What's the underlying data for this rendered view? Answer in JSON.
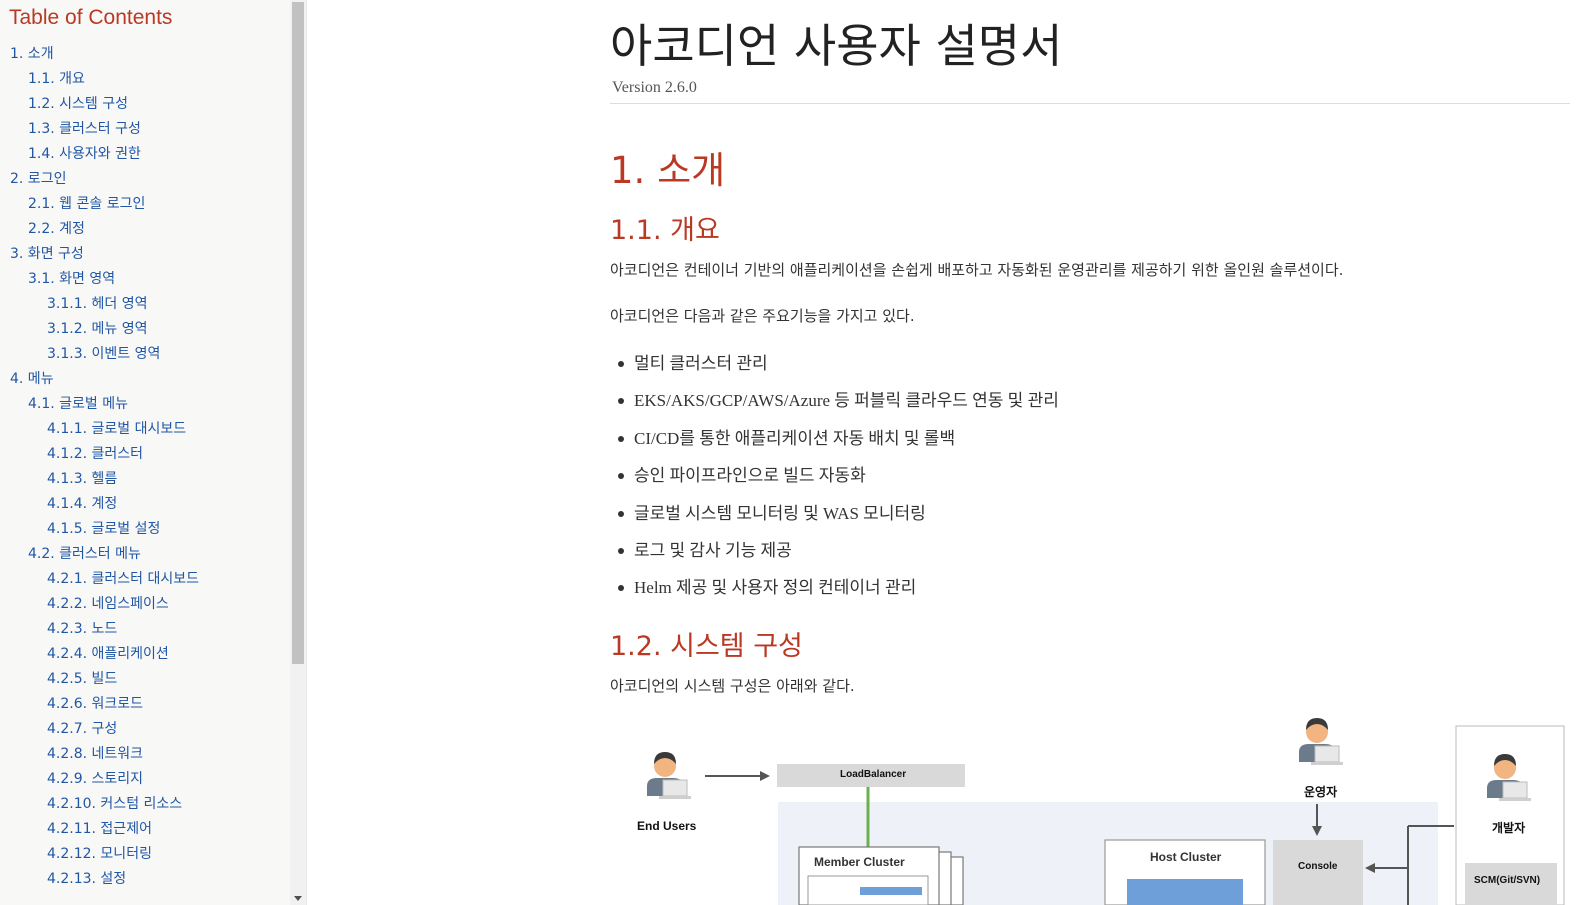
{
  "toc": {
    "title": "Table of Contents",
    "items": [
      {
        "label": "1. 소개",
        "level": 1
      },
      {
        "label": "1.1. 개요",
        "level": 2
      },
      {
        "label": "1.2. 시스템 구성",
        "level": 2
      },
      {
        "label": "1.3. 클러스터 구성",
        "level": 2
      },
      {
        "label": "1.4. 사용자와 권한",
        "level": 2
      },
      {
        "label": "2. 로그인",
        "level": 1
      },
      {
        "label": "2.1. 웹 콘솔 로그인",
        "level": 2
      },
      {
        "label": "2.2. 계정",
        "level": 2
      },
      {
        "label": "3. 화면 구성",
        "level": 1
      },
      {
        "label": "3.1. 화면 영역",
        "level": 2
      },
      {
        "label": "3.1.1. 헤더 영역",
        "level": 3
      },
      {
        "label": "3.1.2. 메뉴 영역",
        "level": 3
      },
      {
        "label": "3.1.3. 이벤트 영역",
        "level": 3
      },
      {
        "label": "4. 메뉴",
        "level": 1
      },
      {
        "label": "4.1. 글로벌 메뉴",
        "level": 2
      },
      {
        "label": "4.1.1. 글로벌 대시보드",
        "level": 3
      },
      {
        "label": "4.1.2. 클러스터",
        "level": 3
      },
      {
        "label": "4.1.3. 헬름",
        "level": 3
      },
      {
        "label": "4.1.4. 계정",
        "level": 3
      },
      {
        "label": "4.1.5. 글로벌 설정",
        "level": 3
      },
      {
        "label": "4.2. 클러스터 메뉴",
        "level": 2
      },
      {
        "label": "4.2.1. 클러스터 대시보드",
        "level": 3
      },
      {
        "label": "4.2.2. 네임스페이스",
        "level": 3
      },
      {
        "label": "4.2.3. 노드",
        "level": 3
      },
      {
        "label": "4.2.4. 애플리케이션",
        "level": 3
      },
      {
        "label": "4.2.5. 빌드",
        "level": 3
      },
      {
        "label": "4.2.6. 워크로드",
        "level": 3
      },
      {
        "label": "4.2.7. 구성",
        "level": 3
      },
      {
        "label": "4.2.8. 네트워크",
        "level": 3
      },
      {
        "label": "4.2.9. 스토리지",
        "level": 3
      },
      {
        "label": "4.2.10. 커스텀 리소스",
        "level": 3
      },
      {
        "label": "4.2.11. 접근제어",
        "level": 3
      },
      {
        "label": "4.2.12. 모니터링",
        "level": 3
      },
      {
        "label": "4.2.13. 설정",
        "level": 3
      }
    ]
  },
  "document": {
    "title": "아코디언 사용자 설명서",
    "version": "Version 2.6.0",
    "section1_heading": "1. 소개",
    "section1_1_heading": "1.1. 개요",
    "intro_paragraph": "아코디언은 컨테이너 기반의 애플리케이션을 손쉽게 배포하고 자동화된 운영관리를 제공하기 위한 올인원 솔루션이다.",
    "features_intro": "아코디언은 다음과 같은 주요기능을 가지고 있다.",
    "features": [
      "멀티 클러스터 관리",
      "EKS/AKS/GCP/AWS/Azure 등 퍼블릭 클라우드 연동 및 관리",
      "CI/CD를 통한 애플리케이션 자동 배치 및 롤백",
      "승인 파이프라인으로 빌드 자동화",
      "글로벌 시스템 모니터링 및 WAS 모니터링",
      "로그 및 감사 기능 제공",
      "Helm 제공 및 사용자 정의 컨테이너 관리"
    ],
    "section1_2_heading": "1.2. 시스템 구성",
    "system_paragraph": "아코디언의 시스템 구성은 아래와 같다."
  },
  "diagram": {
    "end_users": "End Users",
    "load_balancer": "LoadBalancer",
    "member_cluster": "Member Cluster",
    "operator": "운영자",
    "host_cluster": "Host Cluster",
    "console": "Console",
    "developer": "개발자",
    "scm": "SCM(Git/SVN)"
  },
  "colors": {
    "heading": "#ba3925",
    "toc_link": "#2156a5",
    "body_text": "#333333"
  }
}
